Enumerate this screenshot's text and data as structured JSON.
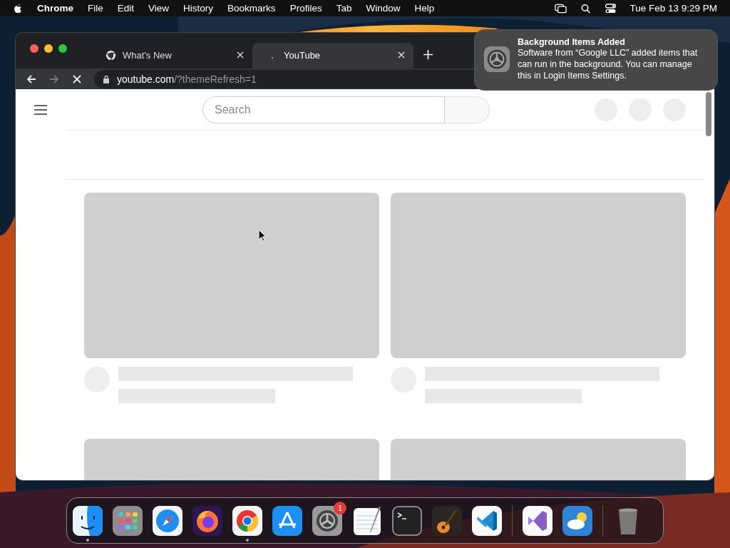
{
  "menubar": {
    "app": "Chrome",
    "menus": [
      "File",
      "Edit",
      "View",
      "History",
      "Bookmarks",
      "Profiles",
      "Tab",
      "Window",
      "Help"
    ],
    "clock": "Tue Feb 13  9:29 PM"
  },
  "browser": {
    "tabs": [
      {
        "title": "What's New",
        "selected": false,
        "kind": "chrome"
      },
      {
        "title": "YouTube",
        "selected": true,
        "kind": "loading"
      }
    ],
    "url": {
      "host": "youtube.com",
      "path": "/?themeRefresh=1"
    },
    "loading": true,
    "page": {
      "search_placeholder": "Search",
      "feed": [
        {
          "kind": "skeleton"
        },
        {
          "kind": "skeleton"
        },
        {
          "kind": "thumbnail"
        },
        {
          "kind": "thumbnail"
        }
      ]
    }
  },
  "notification": {
    "title": "Background Items Added",
    "body": "Software from “Google LLC” added items that can run in the background. You can manage this in Login Items Settings."
  },
  "dock": [
    {
      "kind": "finder",
      "running": true
    },
    {
      "kind": "launchpad",
      "running": false
    },
    {
      "kind": "safari",
      "running": false
    },
    {
      "kind": "firefox",
      "running": false
    },
    {
      "kind": "chrome",
      "running": true
    },
    {
      "kind": "appstore",
      "running": false
    },
    {
      "kind": "settings",
      "running": false,
      "badge": "1"
    },
    {
      "kind": "textedit",
      "running": false
    },
    {
      "kind": "terminal",
      "running": false
    },
    {
      "kind": "guitar",
      "running": false
    },
    {
      "kind": "vscode",
      "running": false
    },
    {
      "kind": "separator"
    },
    {
      "kind": "visualstudio",
      "running": false
    },
    {
      "kind": "weather",
      "running": false
    },
    {
      "kind": "separator"
    },
    {
      "kind": "trash",
      "running": false
    }
  ]
}
